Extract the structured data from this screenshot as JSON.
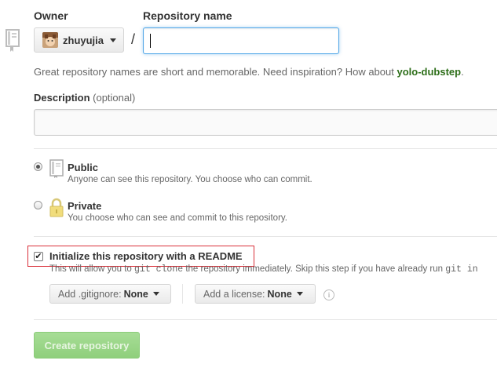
{
  "owner": {
    "label": "Owner",
    "name": "zhuyujia"
  },
  "repo_name": {
    "label": "Repository name",
    "value": "",
    "separator": "/"
  },
  "hint": {
    "text": "Great repository names are short and memorable. Need inspiration? How about ",
    "suggestion": "yolo-dubstep",
    "end": "."
  },
  "description": {
    "label": "Description",
    "optional": "(optional)",
    "value": ""
  },
  "visibility": {
    "selected": "public",
    "public": {
      "title": "Public",
      "desc": "Anyone can see this repository. You choose who can commit."
    },
    "private": {
      "title": "Private",
      "desc": "You choose who can see and commit to this repository."
    }
  },
  "readme": {
    "checked": true,
    "label": "Initialize this repository with a README",
    "desc_before": "This will allow you to ",
    "desc_code": "git clone",
    "desc_after": " the repository immediately. Skip this step if you have already run ",
    "desc_code2": "git in"
  },
  "gitignore": {
    "prefix": "Add .gitignore:",
    "value": "None"
  },
  "license": {
    "prefix": "Add a license:",
    "value": "None"
  },
  "create_button": "Create repository",
  "colors": {
    "accent_blue": "#51a7e8",
    "suggest_green": "#2d6e19",
    "button_green": "#94d381",
    "highlight_red": "#d9303a"
  }
}
